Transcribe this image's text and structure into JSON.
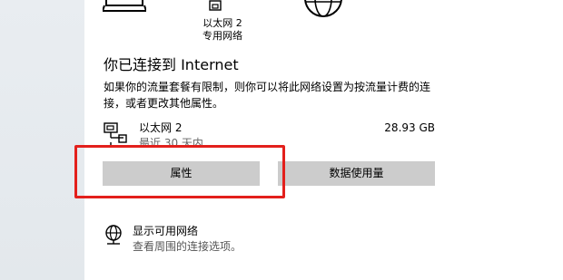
{
  "diagram": {
    "computer_icon": "computer-icon",
    "adapter_icon": "ethernet-adapter-icon",
    "adapter_label_line1": "以太网 2",
    "adapter_label_line2": "专用网络",
    "globe_icon": "globe-icon"
  },
  "status": {
    "title": "你已连接到 Internet",
    "description": "如果你的流量套餐有限制，则你可以将此网络设置为按流量计费的连接，或者更改其他属性。"
  },
  "network": {
    "icon": "ethernet-network-icon",
    "name": "以太网 2",
    "period": "最近 30 天内",
    "usage": "28.93 GB"
  },
  "buttons": {
    "properties_label": "属性",
    "data_usage_label": "数据使用量"
  },
  "available": {
    "icon": "network-globe-icon",
    "title": "显示可用网络",
    "description": "查看周围的连接选项。"
  },
  "colors": {
    "highlight": "#e3201c",
    "button_bg": "#cccccc",
    "side_panel": "#e6eaee"
  }
}
